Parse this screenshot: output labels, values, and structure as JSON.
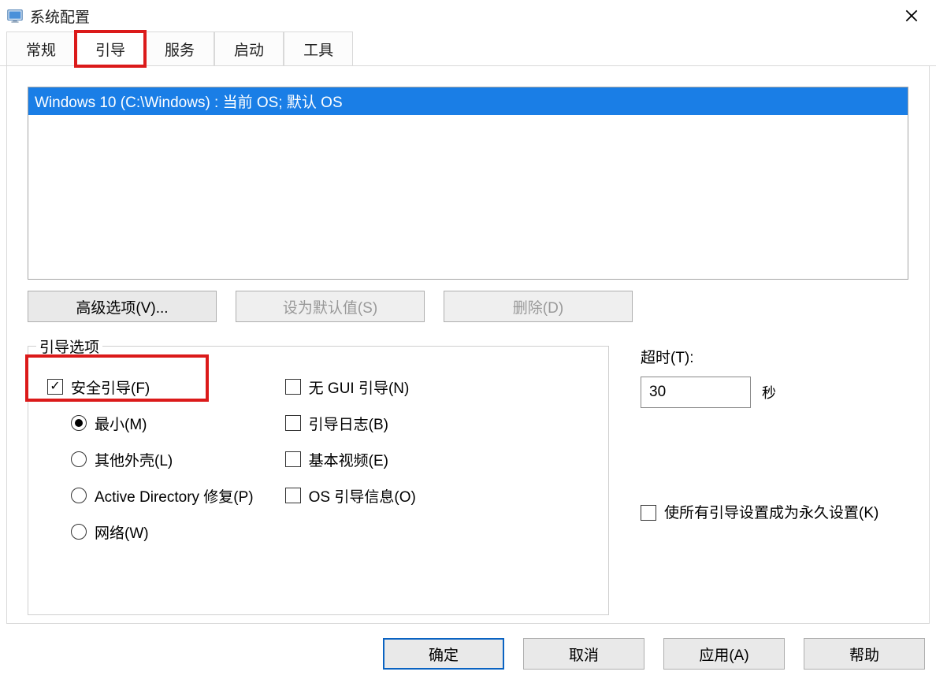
{
  "window": {
    "title": "系统配置"
  },
  "tabs": {
    "general": "常规",
    "boot": "引导",
    "services": "服务",
    "startup": "启动",
    "tools": "工具"
  },
  "os_list": {
    "item": "Windows 10 (C:\\Windows) : 当前 OS; 默认 OS"
  },
  "buttons": {
    "advanced": "高级选项(V)...",
    "set_default": "设为默认值(S)",
    "delete": "删除(D)"
  },
  "boot_options": {
    "legend": "引导选项",
    "safe_boot": "安全引导(F)",
    "minimal": "最小(M)",
    "alt_shell": "其他外壳(L)",
    "ad_repair": "Active Directory 修复(P)",
    "network": "网络(W)",
    "no_gui": "无 GUI 引导(N)",
    "boot_log": "引导日志(B)",
    "base_video": "基本视频(E)",
    "os_info": "OS 引导信息(O)"
  },
  "timeout": {
    "label": "超时(T):",
    "value": "30",
    "unit": "秒"
  },
  "permanent": {
    "label": "使所有引导设置成为永久设置(K)"
  },
  "dialog_buttons": {
    "ok": "确定",
    "cancel": "取消",
    "apply": "应用(A)",
    "help": "帮助"
  }
}
